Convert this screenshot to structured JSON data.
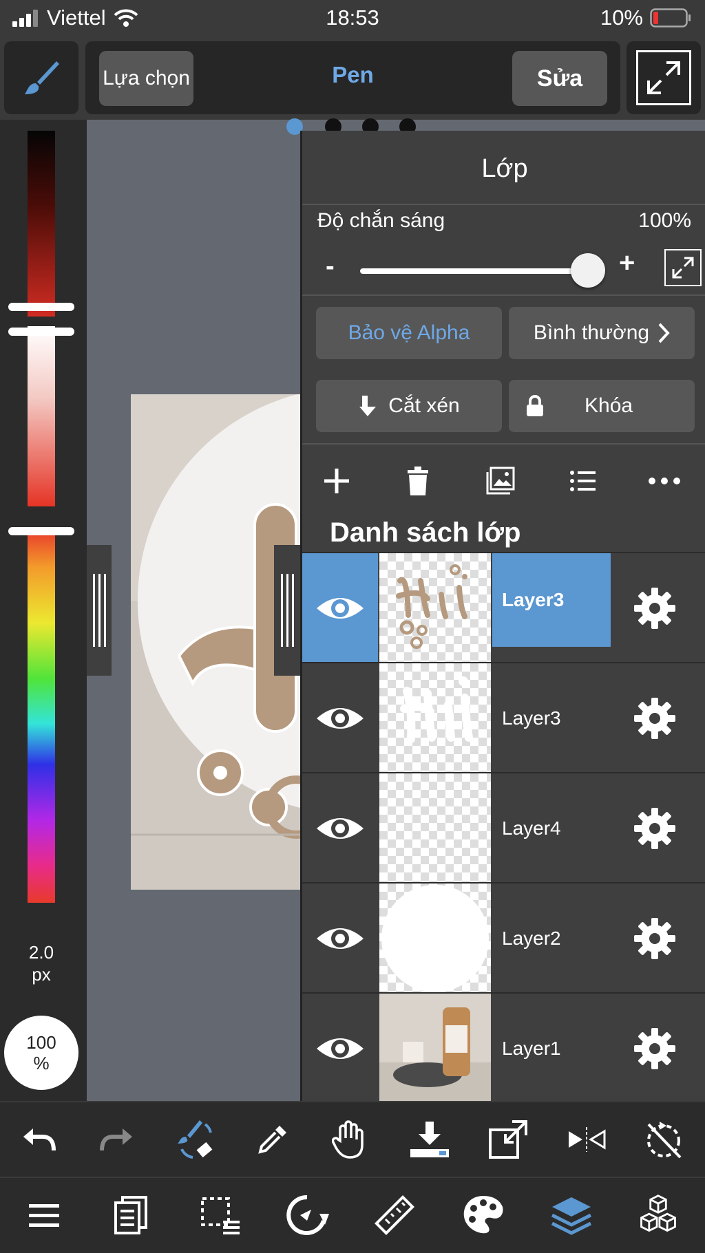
{
  "status_bar": {
    "carrier": "Viettel",
    "time": "18:53",
    "battery": "10%"
  },
  "toolbar": {
    "select_label": "Lựa chọn",
    "tool_name": "Pen",
    "edit_label": "Sửa"
  },
  "color_panel": {
    "brush_size": "2.0",
    "brush_unit": "px",
    "opacity_value": "100",
    "opacity_unit": "%"
  },
  "layers_panel": {
    "title": "Lớp",
    "opacity_label": "Độ chắn sáng",
    "opacity_value": "100%",
    "opacity_fraction": 1.0,
    "minus": "-",
    "plus": "+",
    "alpha_protect": "Bảo vệ Alpha",
    "blend_mode": "Bình thường",
    "clipping": "Cắt xén",
    "lock": "Khóa",
    "list_title": "Danh sách lớp",
    "layers": [
      {
        "name": "Layer3",
        "selected": true
      },
      {
        "name": "Layer3",
        "selected": false
      },
      {
        "name": "Layer4",
        "selected": false
      },
      {
        "name": "Layer2",
        "selected": false
      },
      {
        "name": "Layer1",
        "selected": false
      }
    ]
  },
  "colors": {
    "accent": "#5b97d1",
    "panel": "#3f3f3f",
    "background": "#2b2b2b",
    "tan": "#b59a7f"
  }
}
